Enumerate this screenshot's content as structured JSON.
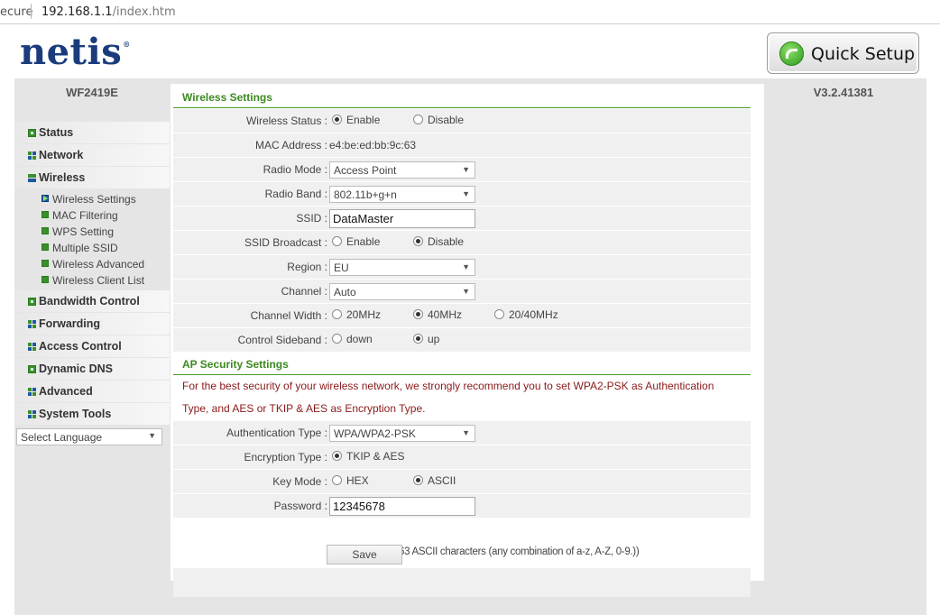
{
  "browser": {
    "secure_text": "ecure",
    "url_host": "192.168.1.1",
    "url_path": "/index.htm"
  },
  "header": {
    "logo": "netis",
    "logo_mark": "®",
    "quick_setup_label": "Quick Setup",
    "model": "WF2419E",
    "version": "V3.2.41381"
  },
  "sidebar": {
    "items": [
      {
        "label": "Status",
        "icon": "plus-icon"
      },
      {
        "label": "Network",
        "icon": "grid-icon"
      },
      {
        "label": "Wireless",
        "icon": "open-icon"
      },
      {
        "label": "Bandwidth Control",
        "icon": "plus-icon"
      },
      {
        "label": "Forwarding",
        "icon": "grid-icon"
      },
      {
        "label": "Access Control",
        "icon": "grid-icon"
      },
      {
        "label": "Dynamic DNS",
        "icon": "plus-icon"
      },
      {
        "label": "Advanced",
        "icon": "grid-icon"
      },
      {
        "label": "System Tools",
        "icon": "grid-icon"
      }
    ],
    "wireless_sub": [
      "Wireless Settings",
      "MAC Filtering",
      "WPS Setting",
      "Multiple SSID",
      "Wireless Advanced",
      "Wireless Client List"
    ],
    "language_select": "Select Language"
  },
  "wireless": {
    "title": "Wireless Settings",
    "status_label": "Wireless Status :",
    "status_enable": "Enable",
    "status_disable": "Disable",
    "status_value": "Enable",
    "mac_label": "MAC Address :",
    "mac_value": "e4:be:ed:bb:9c:63",
    "radio_mode_label": "Radio Mode :",
    "radio_mode_value": "Access Point",
    "radio_band_label": "Radio Band :",
    "radio_band_value": "802.11b+g+n",
    "ssid_label": "SSID :",
    "ssid_value": "DataMaster",
    "broadcast_label": "SSID Broadcast :",
    "broadcast_enable": "Enable",
    "broadcast_disable": "Disable",
    "broadcast_value": "Disable",
    "region_label": "Region :",
    "region_value": "EU",
    "channel_label": "Channel :",
    "channel_value": "Auto",
    "width_label": "Channel Width :",
    "width_20": "20MHz",
    "width_40": "40MHz",
    "width_2040": "20/40MHz",
    "width_value": "40MHz",
    "sideband_label": "Control Sideband :",
    "sideband_down": "down",
    "sideband_up": "up",
    "sideband_value": "up"
  },
  "security": {
    "title": "AP Security Settings",
    "notice_line1": "For the best security of your wireless network, we strongly recommend you to set WPA2-PSK as Authentication",
    "notice_line2": "Type, and AES or TKIP & AES as Encryption Type.",
    "auth_label": "Authentication Type :",
    "auth_value": "WPA/WPA2-PSK",
    "enc_label": "Encryption Type :",
    "enc_value": "TKIP & AES",
    "key_label": "Key Mode :",
    "key_hex": "HEX",
    "key_ascii": "ASCII",
    "key_value": "ASCII",
    "password_label": "Password :",
    "password_value": "12345678",
    "password_hint": "(Please enter 8-63 ASCII characters (any combination of a-z, A-Z, 0-9.))",
    "save_label": "Save"
  }
}
